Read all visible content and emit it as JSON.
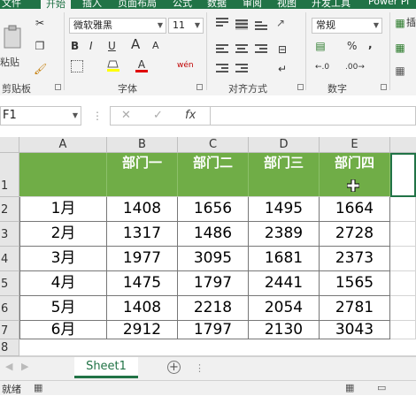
{
  "ribbon_tabs": [
    "文件",
    "开始",
    "插入",
    "页面布局",
    "公式",
    "数据",
    "审阅",
    "视图",
    "开发工具",
    "Power Pi"
  ],
  "clipboard": {
    "paste_label": "粘贴",
    "group_label": "剪贴板"
  },
  "font": {
    "name": "微软雅黑",
    "size": "11",
    "group_label": "字体",
    "bold": "B",
    "italic": "I",
    "underline": "U",
    "grow": "A",
    "shrink": "A",
    "font_color": "A",
    "wen": "wén"
  },
  "alignment": {
    "group_label": "对齐方式"
  },
  "number": {
    "format": "常规",
    "percent": "%",
    "comma": ",",
    "group_label": "数字",
    "insert_label": "插"
  },
  "formula_bar": {
    "name_box": "F1",
    "cancel": "✕",
    "enter": "✓",
    "fx": "fx",
    "value": ""
  },
  "columns": [
    "A",
    "B",
    "C",
    "D",
    "E"
  ],
  "rows": [
    "1",
    "2",
    "3",
    "4",
    "5",
    "6",
    "7",
    "8"
  ],
  "header_row": [
    "",
    "部门一",
    "部门二",
    "部门三",
    "部门四"
  ],
  "table_rows": [
    [
      "1月",
      "1408",
      "1656",
      "1495",
      "1664"
    ],
    [
      "2月",
      "1317",
      "1486",
      "2389",
      "2728"
    ],
    [
      "3月",
      "1977",
      "3095",
      "1681",
      "2373"
    ],
    [
      "4月",
      "1475",
      "1797",
      "2441",
      "1565"
    ],
    [
      "5月",
      "1408",
      "2218",
      "2054",
      "2781"
    ],
    [
      "6月",
      "2912",
      "1797",
      "2130",
      "3043"
    ]
  ],
  "sheet": {
    "tab": "Sheet1",
    "add": "+"
  },
  "status": {
    "ready": "就绪"
  },
  "colors": {
    "header_fill": "#70ad47",
    "ribbon_green": "#217346"
  }
}
